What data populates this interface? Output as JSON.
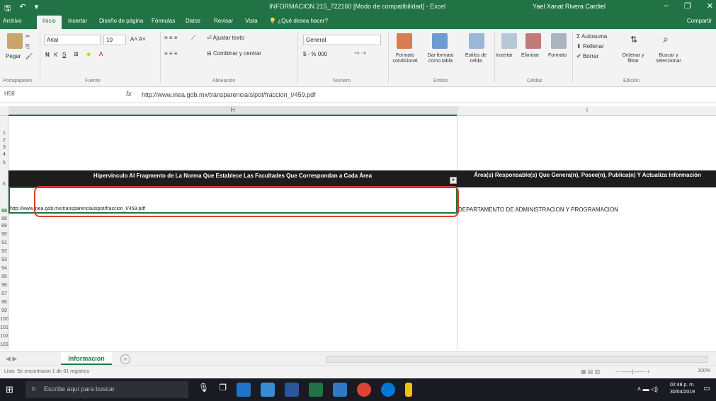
{
  "titlebar": {
    "doc_title": "INFORMACION 215_722160  [Modo de compatibilidad] - Excel",
    "user": "Yael Xanat Rivera Cardiel",
    "minimize": "–",
    "restore": "❐",
    "close": "✕"
  },
  "tabs": [
    "Archivo",
    "Inicio",
    "Insertar",
    "Diseño de página",
    "Fórmulas",
    "Datos",
    "Revisar",
    "Vista"
  ],
  "tell_me": "¿Qué desea hacer?",
  "share": "Compartir",
  "ribbon": {
    "paste": "Pegar",
    "font_name": "Arial",
    "font_size": "10",
    "bold": "N",
    "italic": "K",
    "underline": "S",
    "wrap_text": "Ajustar texto",
    "merge_center": "Combinar y centrar",
    "number_format": "General",
    "currency": "$ - % 000",
    "conditional_format": "Formato condicional",
    "format_as_table": "Dar formato como tabla",
    "cell_styles": "Estilos de celda",
    "insert": "Insertar",
    "delete": "Eliminar",
    "format": "Formato",
    "autosum": "Autosuma",
    "fill": "Rellenar",
    "clear": "Borrar",
    "sort_filter": "Ordenar y filtrar",
    "find_select": "Buscar y seleccionar",
    "groups": [
      "Portapapeles",
      "Fuente",
      "Alineación",
      "Número",
      "Estilos",
      "Celdas",
      "Edición"
    ]
  },
  "formula_bar": {
    "name_box": "H58",
    "fx": "fx",
    "formula": "http://www.inea.gob.mx/transparencia/sipot/fraccion_I/459.pdf"
  },
  "columns": {
    "H": "H",
    "I": "I"
  },
  "rows": [
    "1",
    "2",
    "3",
    "4",
    "5",
    "6",
    "58",
    "88",
    "89",
    "90",
    "91",
    "92",
    "93",
    "94",
    "95",
    "96",
    "97",
    "98",
    "99",
    "100",
    "101",
    "102",
    "103"
  ],
  "headers": {
    "H": "Hipervinculo Al Fragmento de La Norma Que Establece Las Facultades Que Correspondan a Cada Área",
    "I": "Área(s) Responsable(s) Que Genera(n), Posee(n), Publica(n) Y Actualiza Información"
  },
  "filter_glyph": "▾",
  "cells": {
    "H58": "http://www.inea.gob.mx/transparencia/sipot/fraccion_I/459.pdf",
    "I58": "DEPARTAMENTO DE ADMINISTRACION Y PROGRAMACION"
  },
  "sheet_tab": "Informacion",
  "add_sheet": "+",
  "status": {
    "ready": "Listo",
    "records": "Se encontraron 1 de 81 registros",
    "zoom": "100%"
  },
  "taskbar": {
    "search_placeholder": "Escribe aquí para buscar",
    "time": "02:48 p. m.",
    "date": "30/04/2019"
  },
  "colors": {
    "excel_green": "#217346",
    "highlight_red": "#d9432f",
    "header_band": "#1d1d1d"
  }
}
